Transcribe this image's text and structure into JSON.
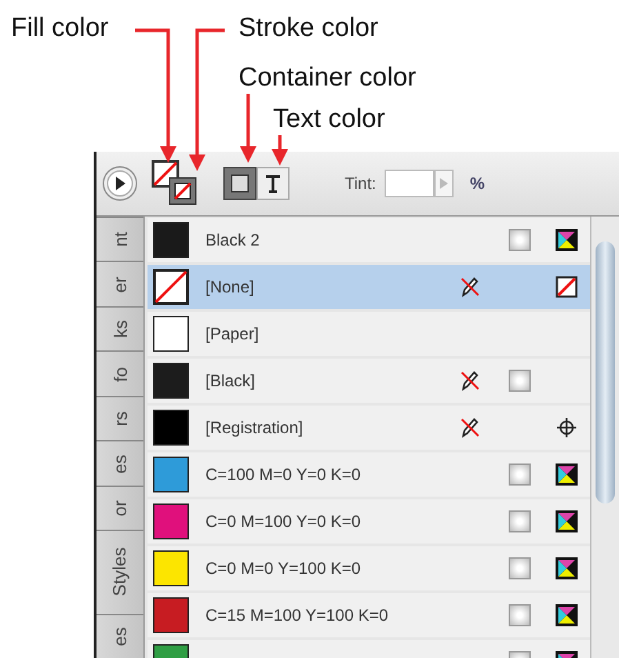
{
  "annotations": [
    {
      "kind": "fill",
      "text": "Fill color"
    },
    {
      "kind": "stroke",
      "text": "Stroke color"
    },
    {
      "kind": "container",
      "text": "Container color"
    },
    {
      "kind": "text",
      "text": "Text color"
    }
  ],
  "side_tabs": [
    "nt",
    "er",
    "ks",
    "fo",
    "rs",
    "es",
    "or",
    "Styles",
    "es"
  ],
  "toolbar": {
    "toggles": [
      {
        "kind": "container",
        "selected": true
      },
      {
        "kind": "text",
        "selected": false
      }
    ],
    "tint_label": "Tint:",
    "unit": "%"
  },
  "swatches": [
    {
      "name": "Black 2",
      "kind": "solid",
      "color": "#1a1a1a",
      "selected": false,
      "locked": false,
      "process": true,
      "mode": {
        "kind": "cmyk"
      }
    },
    {
      "name": "[None]",
      "kind": "none",
      "selected": true,
      "locked": true,
      "process": false,
      "mode": {
        "kind": "none"
      }
    },
    {
      "name": "[Paper]",
      "kind": "solid",
      "color": "#ffffff",
      "selected": false,
      "locked": false,
      "process": false
    },
    {
      "name": "[Black]",
      "kind": "solid",
      "color": "#1c1c1c",
      "selected": false,
      "locked": true,
      "process": true
    },
    {
      "name": "[Registration]",
      "kind": "solid",
      "color": "#000000",
      "selected": false,
      "locked": true,
      "process": false,
      "mode": {
        "kind": "registration"
      }
    },
    {
      "name": "C=100 M=0 Y=0 K=0",
      "kind": "solid",
      "color": "#2e9bd9",
      "selected": false,
      "locked": false,
      "process": true,
      "mode": {
        "kind": "cmyk"
      }
    },
    {
      "name": "C=0 M=100 Y=0 K=0",
      "kind": "solid",
      "color": "#e0107c",
      "selected": false,
      "locked": false,
      "process": true,
      "mode": {
        "kind": "cmyk"
      }
    },
    {
      "name": "C=0 M=0 Y=100 K=0",
      "kind": "solid",
      "color": "#fce500",
      "selected": false,
      "locked": false,
      "process": true,
      "mode": {
        "kind": "cmyk"
      }
    },
    {
      "name": "C=15 M=100 Y=100 K=0",
      "kind": "solid",
      "color": "#c71c22",
      "selected": false,
      "locked": false,
      "process": true,
      "mode": {
        "kind": "cmyk"
      }
    },
    {
      "kind": "solid",
      "color": "#2f9e44",
      "selected": false,
      "locked": false,
      "process": true,
      "mode": {
        "kind": "cmyk"
      }
    }
  ]
}
